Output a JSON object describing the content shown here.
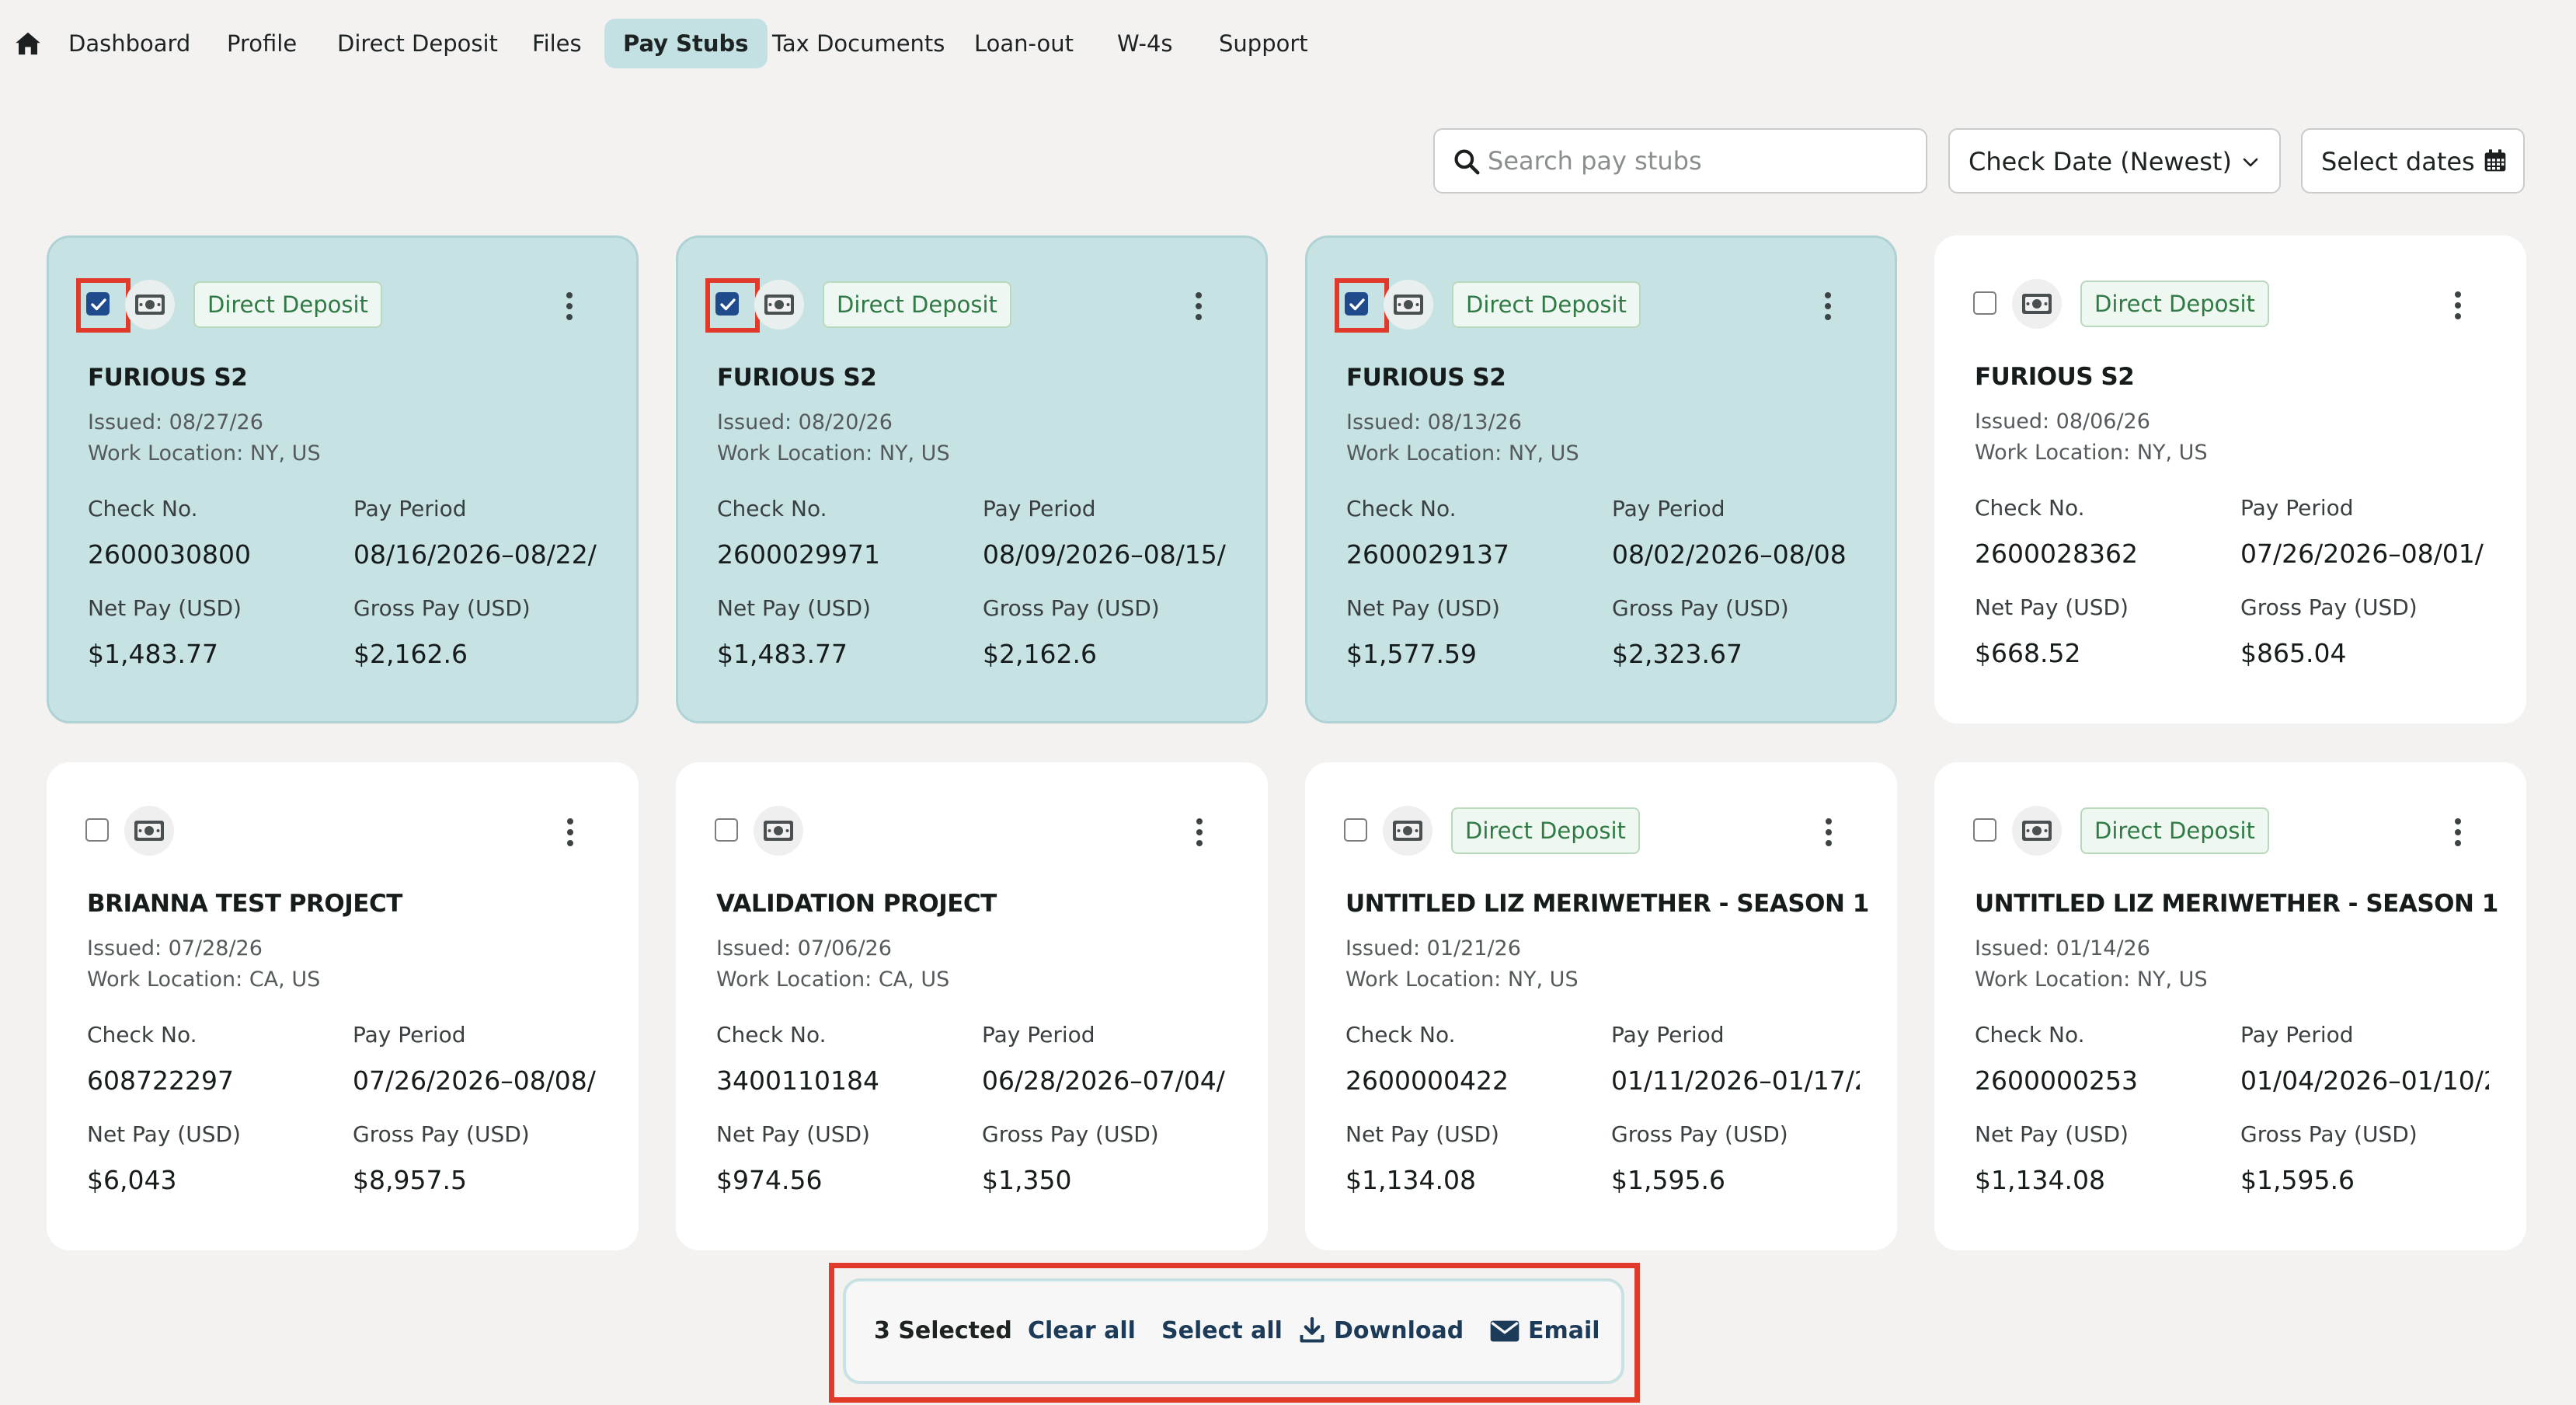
{
  "nav": {
    "tabs": [
      "Dashboard",
      "Profile",
      "Direct Deposit",
      "Files",
      "Pay Stubs",
      "Tax Documents",
      "Loan-out",
      "W-4s",
      "Support"
    ],
    "active": "Pay Stubs"
  },
  "toolbar": {
    "search_placeholder": "Search pay stubs",
    "sort_label": "Check Date (Newest)",
    "dates_label": "Select dates"
  },
  "labels": {
    "check_no": "Check No.",
    "pay_period": "Pay Period",
    "net_pay": "Net Pay (USD)",
    "gross_pay": "Gross Pay (USD)"
  },
  "cards": [
    {
      "selected": true,
      "badge": "Direct Deposit",
      "title": "FURIOUS S2",
      "issued": "Issued: 08/27/26",
      "location": "Work Location: NY, US",
      "check_no": "2600030800",
      "pay_period": "08/16/2026–08/22/",
      "net_pay": "$1,483.77",
      "gross_pay": "$2,162.6"
    },
    {
      "selected": true,
      "badge": "Direct Deposit",
      "title": "FURIOUS S2",
      "issued": "Issued: 08/20/26",
      "location": "Work Location: NY, US",
      "check_no": "2600029971",
      "pay_period": "08/09/2026–08/15/",
      "net_pay": "$1,483.77",
      "gross_pay": "$2,162.6"
    },
    {
      "selected": true,
      "badge": "Direct Deposit",
      "title": "FURIOUS S2",
      "issued": "Issued: 08/13/26",
      "location": "Work Location: NY, US",
      "check_no": "2600029137",
      "pay_period": "08/02/2026–08/08",
      "net_pay": "$1,577.59",
      "gross_pay": "$2,323.67"
    },
    {
      "selected": false,
      "badge": "Direct Deposit",
      "title": "FURIOUS S2",
      "issued": "Issued: 08/06/26",
      "location": "Work Location: NY, US",
      "check_no": "2600028362",
      "pay_period": "07/26/2026–08/01/",
      "net_pay": "$668.52",
      "gross_pay": "$865.04"
    },
    {
      "selected": false,
      "badge": "",
      "title": "BRIANNA TEST PROJECT",
      "issued": "Issued: 07/28/26",
      "location": "Work Location: CA, US",
      "check_no": "608722297",
      "pay_period": "07/26/2026–08/08/",
      "net_pay": "$6,043",
      "gross_pay": "$8,957.5"
    },
    {
      "selected": false,
      "badge": "",
      "title": "VALIDATION PROJECT",
      "issued": "Issued: 07/06/26",
      "location": "Work Location: CA, US",
      "check_no": "3400110184",
      "pay_period": "06/28/2026–07/04/",
      "net_pay": "$974.56",
      "gross_pay": "$1,350"
    },
    {
      "selected": false,
      "badge": "Direct Deposit",
      "title": "UNTITLED LIZ MERIWETHER - SEASON 1",
      "issued": "Issued: 01/21/26",
      "location": "Work Location: NY, US",
      "check_no": "2600000422",
      "pay_period": "01/11/2026–01/17/20",
      "net_pay": "$1,134.08",
      "gross_pay": "$1,595.6"
    },
    {
      "selected": false,
      "badge": "Direct Deposit",
      "title": "UNTITLED LIZ MERIWETHER - SEASON 1",
      "issued": "Issued: 01/14/26",
      "location": "Work Location: NY, US",
      "check_no": "2600000253",
      "pay_period": "01/04/2026–01/10/2",
      "net_pay": "$1,134.08",
      "gross_pay": "$1,595.6"
    }
  ],
  "action_bar": {
    "count": "3 Selected",
    "clear_all": "Clear all",
    "select_all": "Select all",
    "download": "Download",
    "email": "Email"
  },
  "colors": {
    "selected_card": "#c7e2e3",
    "active_tab": "#c3e1e3",
    "badge_text": "#2f7a45",
    "checkbox_checked": "#1f4a8c",
    "highlight": "#e23a2a"
  }
}
